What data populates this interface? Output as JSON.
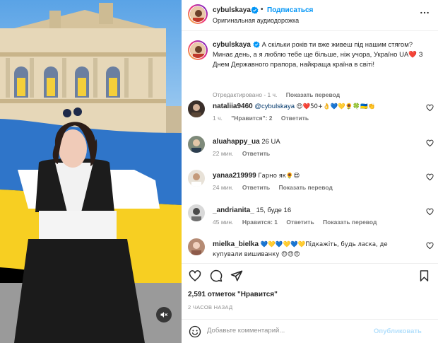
{
  "post": {
    "author": "cybulskaya",
    "follow_label": "Подписаться",
    "audio": "Оригинальная аудиодорожка",
    "caption": {
      "text": "А скільки років ти вже живеш під нашим стягом? Минає день, а я люблю тебе ще більше, ніж учора, Україно UA❤️ З Днем Державного прапора, найкраща країна в світі!",
      "edited": "Отредактировано",
      "time": "1 ч.",
      "translate": "Показать перевод"
    }
  },
  "comments": [
    {
      "user": "nataliia9460",
      "mention": "@cybulskaya",
      "text": "😍❤️50+👌💙💛🌻🍀🇺🇦👏",
      "time": "1 ч.",
      "likes": "\"Нравится\": 2",
      "reply": "Ответить",
      "translate": ""
    },
    {
      "user": "aluahappy_ua",
      "mention": "",
      "text": "26 UA",
      "time": "22 мин.",
      "likes": "",
      "reply": "Ответить",
      "translate": ""
    },
    {
      "user": "yanaa219999",
      "mention": "",
      "text": "Гарно як🌻😍",
      "time": "24 мин.",
      "likes": "",
      "reply": "Ответить",
      "translate": "Показать перевод"
    },
    {
      "user": "_andrianita_",
      "mention": "",
      "text": "15, буде 16",
      "time": "45 мин.",
      "likes": "Нравится: 1",
      "reply": "Ответить",
      "translate": "Показать перевод"
    },
    {
      "user": "mielka_bielka",
      "mention": "",
      "text": "💙💛💙💛💙💛Підкажіть, будь ласка, де купували вишиванку 😍😍😍",
      "time": "",
      "likes": "",
      "reply": "",
      "translate": ""
    }
  ],
  "footer": {
    "likes": "2,591 отметок \"Нравится\"",
    "time": "2 ЧАСОВ НАЗАД",
    "comment_placeholder": "Добавьте комментарий...",
    "publish": "Опубликовать"
  },
  "colors": {
    "link": "#0095f6",
    "flag_blue": "#2f75c9",
    "flag_yellow": "#f7cf22",
    "muted": "#8e8e8e"
  },
  "icons": [
    "verified-badge-icon",
    "more-options-icon",
    "heart-icon",
    "comment-icon",
    "share-icon",
    "bookmark-icon",
    "emoji-icon",
    "speaker-muted-icon"
  ]
}
